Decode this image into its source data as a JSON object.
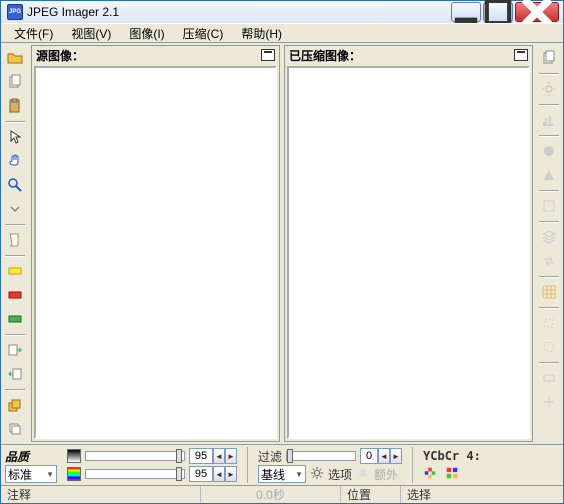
{
  "window": {
    "title": "JPEG Imager 2.1"
  },
  "menu": {
    "file": "文件(F)",
    "view": "视图(V)",
    "image": "图像(I)",
    "compress": "压缩(C)",
    "help": "帮助(H)"
  },
  "panes": {
    "source": "源图像：",
    "compressed": "已压缩图像："
  },
  "bottom": {
    "quality_label": "品质",
    "standard_label": "标准",
    "spin1": "95",
    "spin2": "95",
    "filter_label": "过滤",
    "filter_value": "0",
    "baseline_label": "基线",
    "options_label": "选项",
    "extra_label": "额外",
    "colorspace_label": "YCbCr 4:"
  },
  "status": {
    "comment": "注释",
    "time": "0.0秒",
    "position": "位置",
    "select": "选择"
  }
}
